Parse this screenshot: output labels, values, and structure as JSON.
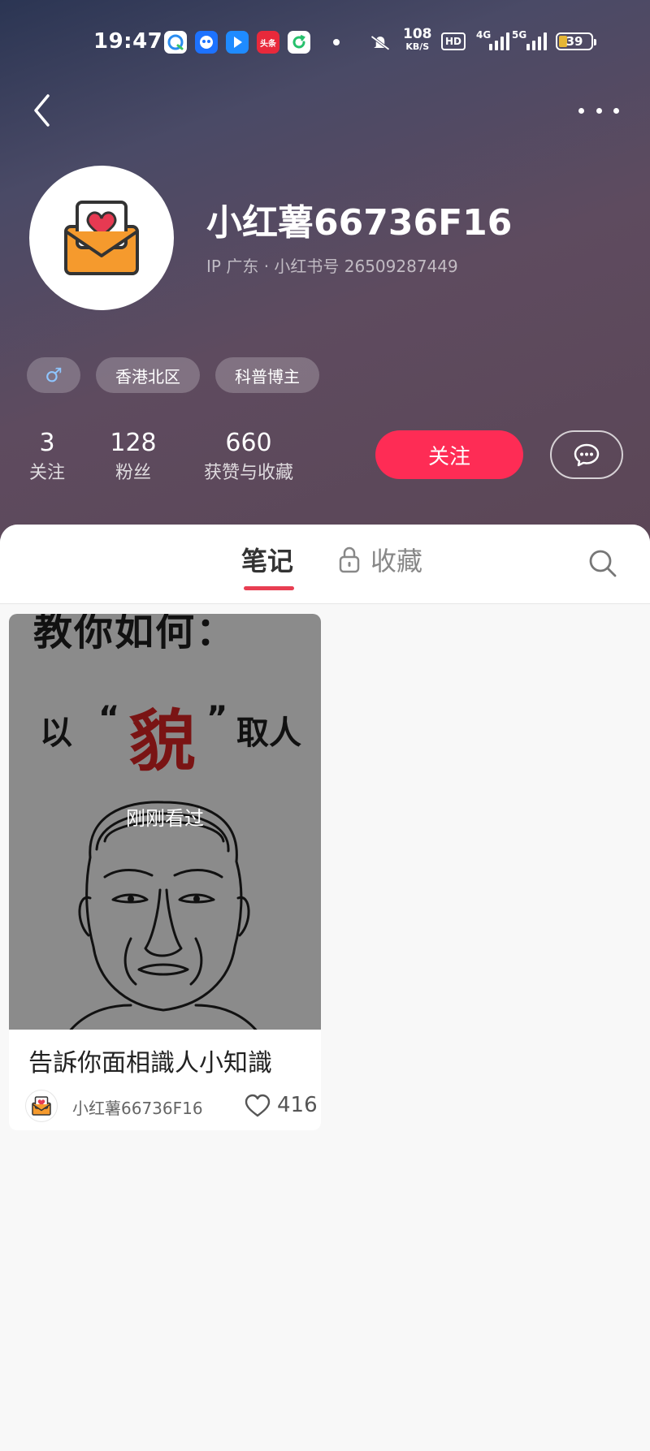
{
  "status_bar": {
    "time": "19:47",
    "net_speed": "108",
    "net_speed_unit": "KB/S",
    "hd_label": "HD",
    "network_4g": "4G",
    "network_5g": "5G",
    "battery": "39",
    "toutiao_label": "头条"
  },
  "profile": {
    "username": "小红薯66736F16",
    "ip_location": "IP 广东",
    "separator": "·",
    "account_id": "小红书号 26509287449",
    "gender_symbol": "♂",
    "tags": [
      "香港北区",
      "科普博主"
    ],
    "stats": [
      {
        "value": "3",
        "label": "关注"
      },
      {
        "value": "128",
        "label": "粉丝"
      },
      {
        "value": "660",
        "label": "获赞与收藏"
      }
    ],
    "follow_label": "关注"
  },
  "tabs": {
    "notes": "笔记",
    "collections": "收藏"
  },
  "notes": [
    {
      "cover_line1": "教你如何：",
      "cover_w1": "以",
      "cover_q1": "“",
      "cover_big": "貌",
      "cover_q2": "”",
      "cover_w2": "取人",
      "overlay_badge": "刚刚看过",
      "title": "告訴你面相識人小知識",
      "author": "小红薯66736F16",
      "likes": "416"
    }
  ],
  "colors": {
    "accent": "#fe2c55",
    "tab_indicator": "#e83e52",
    "avatar_envelope": "#f59a2d",
    "avatar_heart": "#e63a52"
  }
}
